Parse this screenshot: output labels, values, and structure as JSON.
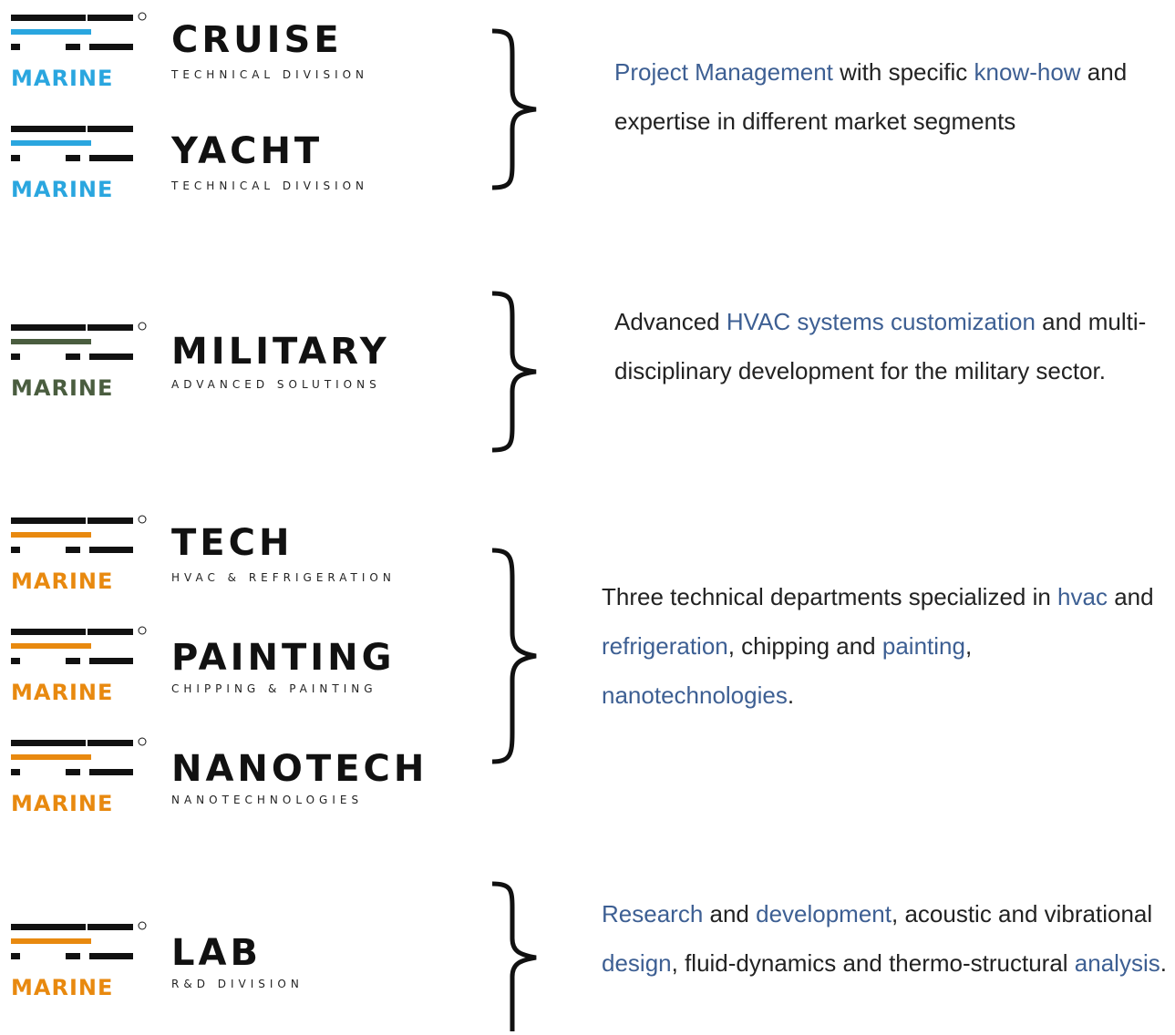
{
  "colors": {
    "cruise_accent": "#2aa6df",
    "military_accent": "#4a5d3f",
    "orange_accent": "#e8890f",
    "text_highlight": "#3d5f93",
    "text_dark": "#222222"
  },
  "groups": [
    {
      "logos": [
        {
          "marine": "MARINE",
          "name": "CRUISE",
          "sub": "TECHNICAL DIVISION",
          "accent": "#2aa6df"
        },
        {
          "marine": "MARINE",
          "name": "YACHT",
          "sub": "TECHNICAL DIVISION",
          "accent": "#2aa6df"
        }
      ],
      "description": [
        {
          "t": "Project Management",
          "hl": true
        },
        {
          "t": " with specific ",
          "hl": false
        },
        {
          "t": "know-how",
          "hl": true
        },
        {
          "t": " and expertise in different market segments",
          "hl": false
        }
      ]
    },
    {
      "logos": [
        {
          "marine": "MARINE",
          "name": "MILITARY",
          "sub": "ADVANCED SOLUTIONS",
          "accent": "#4a5d3f"
        }
      ],
      "description": [
        {
          "t": "Advanced ",
          "hl": false
        },
        {
          "t": "HVAC systems customization",
          "hl": true
        },
        {
          "t": " and multi-disciplinary development for the military sector.",
          "hl": false
        }
      ]
    },
    {
      "logos": [
        {
          "marine": "MARINE",
          "name": "TECH",
          "sub": "HVAC & REFRIGERATION",
          "accent": "#e8890f"
        },
        {
          "marine": "MARINE",
          "name": "PAINTING",
          "sub": "CHIPPING & PAINTING",
          "accent": "#e8890f"
        },
        {
          "marine": "MARINE",
          "name": "NANOTECH",
          "sub": "NANOTECHNOLOGIES",
          "accent": "#e8890f"
        }
      ],
      "description": [
        {
          "t": "Three technical departments specialized in ",
          "hl": false
        },
        {
          "t": "hvac",
          "hl": true
        },
        {
          "t": " and ",
          "hl": false
        },
        {
          "t": "refrigeration",
          "hl": true
        },
        {
          "t": ", chipping and ",
          "hl": false
        },
        {
          "t": "painting",
          "hl": true
        },
        {
          "t": ", ",
          "hl": false
        },
        {
          "t": "nanotechnologies",
          "hl": true
        },
        {
          "t": ".",
          "hl": false
        }
      ]
    },
    {
      "logos": [
        {
          "marine": "MARINE",
          "name": "LAB",
          "sub": "R&D DIVISION",
          "accent": "#e8890f"
        }
      ],
      "description": [
        {
          "t": "Research",
          "hl": true
        },
        {
          "t": " and ",
          "hl": false
        },
        {
          "t": "development",
          "hl": true
        },
        {
          "t": ", acoustic and vibrational ",
          "hl": false
        },
        {
          "t": "design",
          "hl": true
        },
        {
          "t": ", fluid-dynamics and thermo-structural ",
          "hl": false
        },
        {
          "t": "analysis",
          "hl": true
        },
        {
          "t": ".",
          "hl": false
        }
      ]
    }
  ]
}
